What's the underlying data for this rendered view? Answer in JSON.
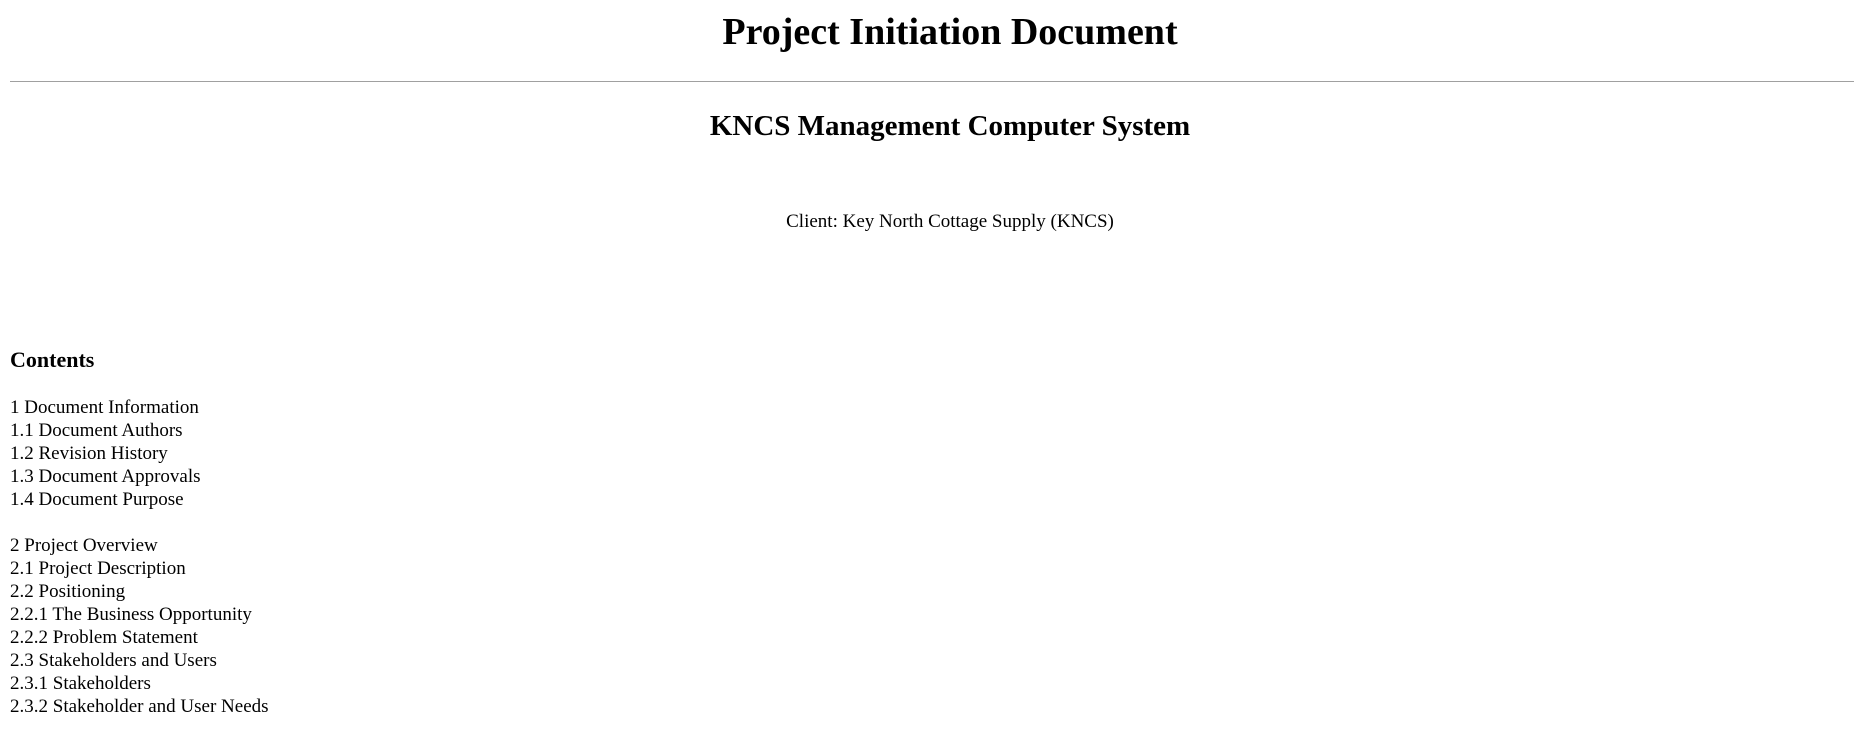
{
  "document": {
    "title": "Project Initiation Document",
    "subtitle": "KNCS Management Computer System",
    "client": "Client: Key North Cottage Supply (KNCS)"
  },
  "contents": {
    "heading": "Contents",
    "groups": [
      {
        "items": [
          "1 Document Information",
          "1.1 Document Authors",
          "1.2 Revision History",
          "1.3 Document Approvals",
          "1.4 Document Purpose"
        ]
      },
      {
        "items": [
          "2 Project Overview",
          "2.1 Project Description",
          "2.2 Positioning",
          "2.2.1 The Business Opportunity",
          "2.2.2 Problem Statement",
          "2.3 Stakeholders and Users",
          "2.3.1 Stakeholders",
          "2.3.2 Stakeholder and User Needs"
        ]
      }
    ]
  }
}
